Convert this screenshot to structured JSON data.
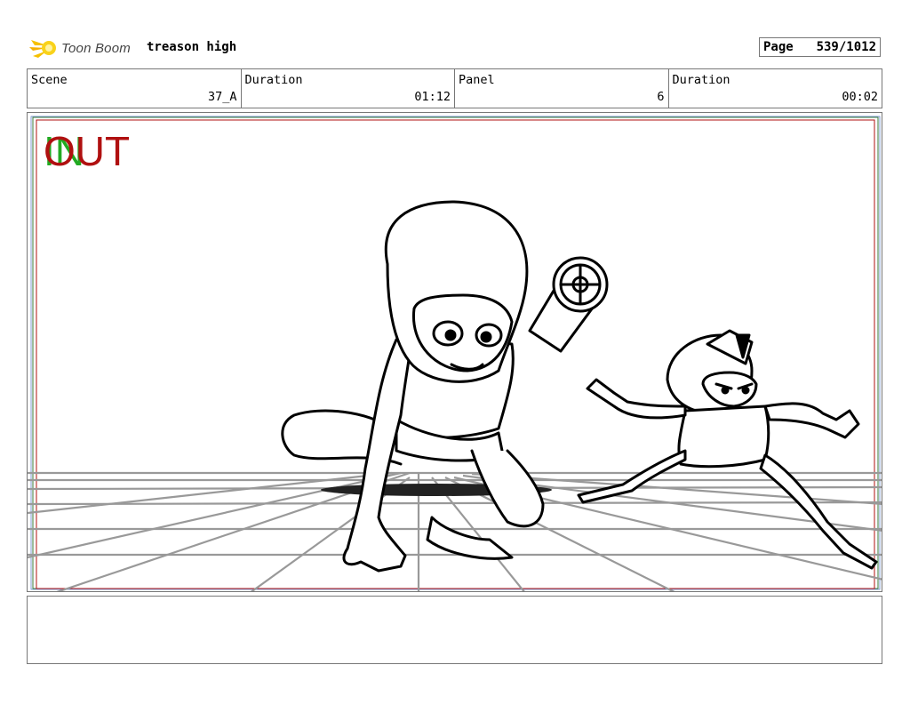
{
  "header": {
    "logo_text": "Toon Boom",
    "project_title": "treason high",
    "page_label": "Page",
    "page_value": "539/1012"
  },
  "info": {
    "scene_label": "Scene",
    "scene_value": "37_A",
    "scene_duration_label": "Duration",
    "scene_duration_value": "01:12",
    "panel_label": "Panel",
    "panel_value": "6",
    "panel_duration_label": "Duration",
    "panel_duration_value": "00:02"
  },
  "panel_marks": {
    "in_label": "IN",
    "out_label": "OUT",
    "in_color": "#22aa22",
    "out_color": "#b01010"
  },
  "caption": {
    "text": ""
  }
}
